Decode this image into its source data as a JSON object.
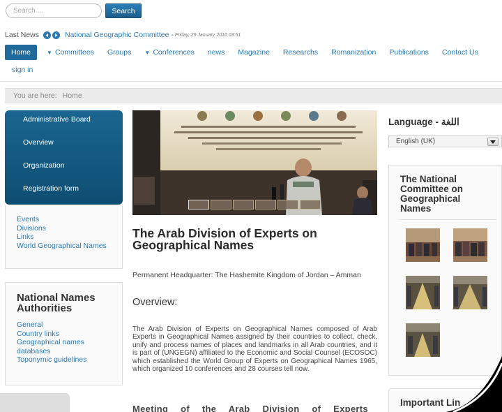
{
  "search": {
    "placeholder": "Search ...",
    "button_label": "Search"
  },
  "news": {
    "label": "Last News",
    "title": "National Geographic Committee -",
    "date": "Friday, 29 January 2016 03:51"
  },
  "nav": {
    "items": [
      {
        "label": "Home",
        "active": true,
        "has_caret": false
      },
      {
        "label": "Committees",
        "active": false,
        "has_caret": true
      },
      {
        "label": "Groups",
        "active": false,
        "has_caret": false
      },
      {
        "label": "Conferences",
        "active": false,
        "has_caret": true
      },
      {
        "label": "news",
        "active": false,
        "has_caret": false
      },
      {
        "label": "Magazine",
        "active": false,
        "has_caret": false
      },
      {
        "label": "Researchs",
        "active": false,
        "has_caret": false
      },
      {
        "label": "Romanization",
        "active": false,
        "has_caret": false
      },
      {
        "label": "Publications",
        "active": false,
        "has_caret": false
      },
      {
        "label": "Contact Us",
        "active": false,
        "has_caret": false
      }
    ],
    "sign_in": "sign in"
  },
  "breadcrumb": {
    "prefix": "You are here:",
    "current": "Home"
  },
  "sidebar": {
    "admin_items": [
      "Administrative Board",
      "Overview",
      "Organization",
      "Registration form"
    ],
    "links": [
      "Events",
      "Divisions",
      "Links",
      "World Geographical Names"
    ],
    "nna_title": "National Names Authorities",
    "nna_links": [
      "General",
      "Country links",
      "Geographical names databases",
      "Toponymic guidelines"
    ]
  },
  "article": {
    "title": "The Arab Division of Experts on Geographical Names",
    "subtitle": "Permanent Headquarter: The Hashemite Kingdom of Jordan – Amman",
    "overview_heading": "Overview:",
    "body": "The Arab Division of Experts on Geographical Names composed of Arab Experts in Geographical Names assigned by their countries to collect, check, unify and process names of places and landmarks in all Arab countries, and it is part of (UNGEGN) affiliated to the Economic and Social Counsel (ECOSOC) which established the World Group of Experts on Geographical Names 1965, which organized 10 conferences and 28 courses tell now.",
    "meeting_heading": "Meeting of the Arab Division of Experts on"
  },
  "right": {
    "language_label": "Language - اللغة",
    "language_selected": "English (UK)",
    "ncgn_title": "The National Committee on Geographical Names",
    "important_title": "Important Lin"
  },
  "colors": {
    "accent": "#2b7ab3",
    "nav_active": "#1f6a9a",
    "sidebar_box": "#0e4d72"
  }
}
